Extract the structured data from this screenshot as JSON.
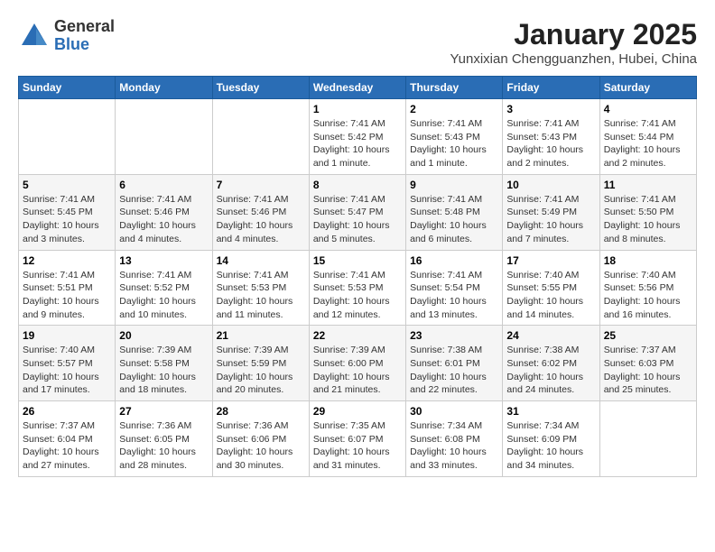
{
  "header": {
    "logo_general": "General",
    "logo_blue": "Blue",
    "title": "January 2025",
    "subtitle": "Yunxixian Chengguanzhen, Hubei, China"
  },
  "weekdays": [
    "Sunday",
    "Monday",
    "Tuesday",
    "Wednesday",
    "Thursday",
    "Friday",
    "Saturday"
  ],
  "weeks": [
    [
      {
        "day": "",
        "info": ""
      },
      {
        "day": "",
        "info": ""
      },
      {
        "day": "",
        "info": ""
      },
      {
        "day": "1",
        "info": "Sunrise: 7:41 AM\nSunset: 5:42 PM\nDaylight: 10 hours\nand 1 minute."
      },
      {
        "day": "2",
        "info": "Sunrise: 7:41 AM\nSunset: 5:43 PM\nDaylight: 10 hours\nand 1 minute."
      },
      {
        "day": "3",
        "info": "Sunrise: 7:41 AM\nSunset: 5:43 PM\nDaylight: 10 hours\nand 2 minutes."
      },
      {
        "day": "4",
        "info": "Sunrise: 7:41 AM\nSunset: 5:44 PM\nDaylight: 10 hours\nand 2 minutes."
      }
    ],
    [
      {
        "day": "5",
        "info": "Sunrise: 7:41 AM\nSunset: 5:45 PM\nDaylight: 10 hours\nand 3 minutes."
      },
      {
        "day": "6",
        "info": "Sunrise: 7:41 AM\nSunset: 5:46 PM\nDaylight: 10 hours\nand 4 minutes."
      },
      {
        "day": "7",
        "info": "Sunrise: 7:41 AM\nSunset: 5:46 PM\nDaylight: 10 hours\nand 4 minutes."
      },
      {
        "day": "8",
        "info": "Sunrise: 7:41 AM\nSunset: 5:47 PM\nDaylight: 10 hours\nand 5 minutes."
      },
      {
        "day": "9",
        "info": "Sunrise: 7:41 AM\nSunset: 5:48 PM\nDaylight: 10 hours\nand 6 minutes."
      },
      {
        "day": "10",
        "info": "Sunrise: 7:41 AM\nSunset: 5:49 PM\nDaylight: 10 hours\nand 7 minutes."
      },
      {
        "day": "11",
        "info": "Sunrise: 7:41 AM\nSunset: 5:50 PM\nDaylight: 10 hours\nand 8 minutes."
      }
    ],
    [
      {
        "day": "12",
        "info": "Sunrise: 7:41 AM\nSunset: 5:51 PM\nDaylight: 10 hours\nand 9 minutes."
      },
      {
        "day": "13",
        "info": "Sunrise: 7:41 AM\nSunset: 5:52 PM\nDaylight: 10 hours\nand 10 minutes."
      },
      {
        "day": "14",
        "info": "Sunrise: 7:41 AM\nSunset: 5:53 PM\nDaylight: 10 hours\nand 11 minutes."
      },
      {
        "day": "15",
        "info": "Sunrise: 7:41 AM\nSunset: 5:53 PM\nDaylight: 10 hours\nand 12 minutes."
      },
      {
        "day": "16",
        "info": "Sunrise: 7:41 AM\nSunset: 5:54 PM\nDaylight: 10 hours\nand 13 minutes."
      },
      {
        "day": "17",
        "info": "Sunrise: 7:40 AM\nSunset: 5:55 PM\nDaylight: 10 hours\nand 14 minutes."
      },
      {
        "day": "18",
        "info": "Sunrise: 7:40 AM\nSunset: 5:56 PM\nDaylight: 10 hours\nand 16 minutes."
      }
    ],
    [
      {
        "day": "19",
        "info": "Sunrise: 7:40 AM\nSunset: 5:57 PM\nDaylight: 10 hours\nand 17 minutes."
      },
      {
        "day": "20",
        "info": "Sunrise: 7:39 AM\nSunset: 5:58 PM\nDaylight: 10 hours\nand 18 minutes."
      },
      {
        "day": "21",
        "info": "Sunrise: 7:39 AM\nSunset: 5:59 PM\nDaylight: 10 hours\nand 20 minutes."
      },
      {
        "day": "22",
        "info": "Sunrise: 7:39 AM\nSunset: 6:00 PM\nDaylight: 10 hours\nand 21 minutes."
      },
      {
        "day": "23",
        "info": "Sunrise: 7:38 AM\nSunset: 6:01 PM\nDaylight: 10 hours\nand 22 minutes."
      },
      {
        "day": "24",
        "info": "Sunrise: 7:38 AM\nSunset: 6:02 PM\nDaylight: 10 hours\nand 24 minutes."
      },
      {
        "day": "25",
        "info": "Sunrise: 7:37 AM\nSunset: 6:03 PM\nDaylight: 10 hours\nand 25 minutes."
      }
    ],
    [
      {
        "day": "26",
        "info": "Sunrise: 7:37 AM\nSunset: 6:04 PM\nDaylight: 10 hours\nand 27 minutes."
      },
      {
        "day": "27",
        "info": "Sunrise: 7:36 AM\nSunset: 6:05 PM\nDaylight: 10 hours\nand 28 minutes."
      },
      {
        "day": "28",
        "info": "Sunrise: 7:36 AM\nSunset: 6:06 PM\nDaylight: 10 hours\nand 30 minutes."
      },
      {
        "day": "29",
        "info": "Sunrise: 7:35 AM\nSunset: 6:07 PM\nDaylight: 10 hours\nand 31 minutes."
      },
      {
        "day": "30",
        "info": "Sunrise: 7:34 AM\nSunset: 6:08 PM\nDaylight: 10 hours\nand 33 minutes."
      },
      {
        "day": "31",
        "info": "Sunrise: 7:34 AM\nSunset: 6:09 PM\nDaylight: 10 hours\nand 34 minutes."
      },
      {
        "day": "",
        "info": ""
      }
    ]
  ]
}
